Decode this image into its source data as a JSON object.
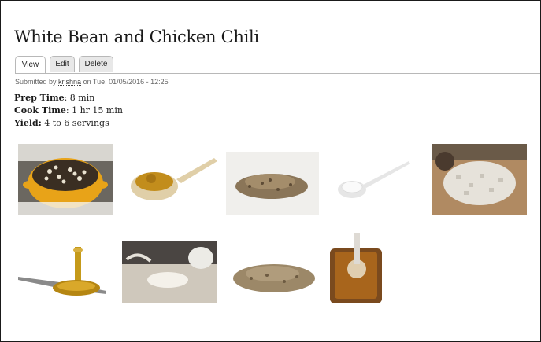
{
  "page": {
    "title": "White Bean and Chicken Chili"
  },
  "tabs": [
    {
      "label": "View",
      "active": true
    },
    {
      "label": "Edit",
      "active": false
    },
    {
      "label": "Delete",
      "active": false
    }
  ],
  "submitted": {
    "prefix": "Submitted by",
    "author": "krishna",
    "suffix": "on Tue, 01/05/2016 - 12:25"
  },
  "recipe": {
    "prep_label": "Prep Time",
    "prep_value": ": 8 min",
    "cook_label": "Cook Time",
    "cook_value": ": 1 hr 15 min",
    "yield_label": "Yield:",
    "yield_value": " 4 to 6 servings"
  },
  "images": [
    {
      "subject": "pot of white beans and chicken chili"
    },
    {
      "subject": "wooden spoon with ground cumin"
    },
    {
      "subject": "pile of dried oregano"
    },
    {
      "subject": "spoon of salt"
    },
    {
      "subject": "chopped onion on cutting board"
    },
    {
      "subject": "olive oil pouring onto spoon"
    },
    {
      "subject": "minced garlic"
    },
    {
      "subject": "pile of ground spices"
    },
    {
      "subject": "jar of spice with spoon"
    }
  ],
  "colors": {
    "border": "#1a1a1a",
    "tab_border": "#b8b8b8",
    "tab_bg": "#e8e8e8"
  }
}
